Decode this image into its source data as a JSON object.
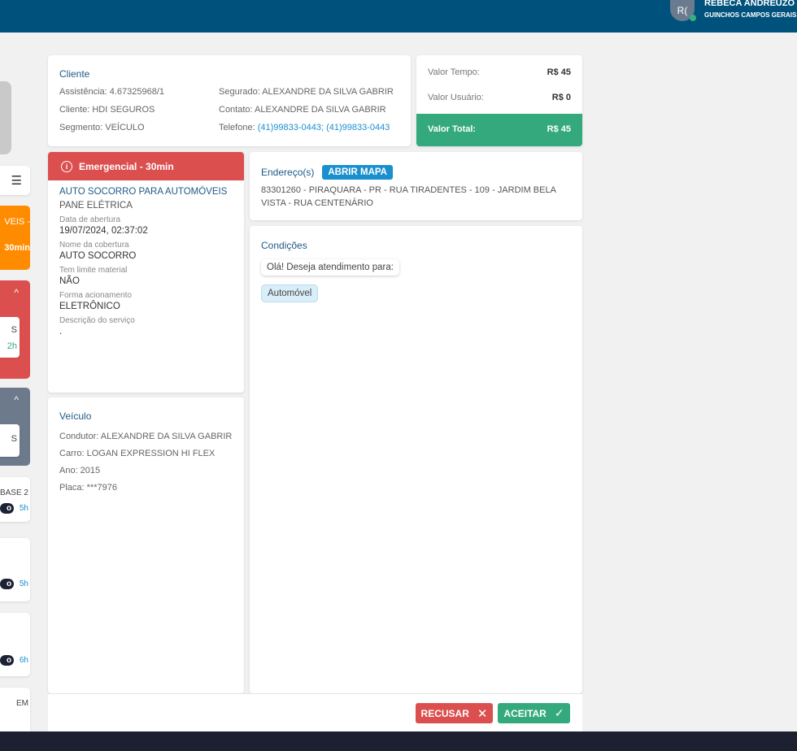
{
  "header": {
    "avatar_initials": "R(",
    "user_name": "REBECA ANDREUZO C",
    "company": "GUINCHOS CAMPOS GERAIS"
  },
  "sidebar": {
    "card1_text": "VEIS -",
    "card1_time": "30min",
    "card2_time": "2h",
    "card2_text": "S",
    "card3_text": "S",
    "card4_text": "BASE 2",
    "card4_badge": "o",
    "card4_time": "5h",
    "card5_badge": "o",
    "card5_time": "5h",
    "card6_badge": "o",
    "card6_time": "6h",
    "card7_text": "EM"
  },
  "cliente": {
    "title": "Cliente",
    "assistencia": "Assistência: 4.67325968/1",
    "cliente": "Cliente: HDI SEGUROS",
    "segmento": "Segmento: VEÍCULO",
    "segurado": "Segurado: ALEXANDRE DA SILVA GABRIR",
    "contato": "Contato: ALEXANDRE DA SILVA GABRIR",
    "telefone_label": "Telefone: ",
    "telefone": "(41)99833-0443; (41)99833-0443"
  },
  "valores": {
    "tempo_label": "Valor Tempo:",
    "tempo": "R$ 45",
    "usuario_label": "Valor Usuário:",
    "usuario": "R$ 0",
    "total_label": "Valor Total:",
    "total": "R$ 45"
  },
  "servico": {
    "priority": "Emergencial - 30min",
    "name": "AUTO SOCORRO PARA AUTOMÓVEIS",
    "problem": "PANE ELÉTRICA",
    "fields": [
      {
        "label": "Data de abertura",
        "value": "19/07/2024, 02:37:02"
      },
      {
        "label": "Nome da cobertura",
        "value": "AUTO SOCORRO"
      },
      {
        "label": "Tem limite material",
        "value": "NÃO"
      },
      {
        "label": "Forma acionamento",
        "value": "ELETRÔNICO"
      },
      {
        "label": "Descrição do serviço",
        "value": "."
      }
    ]
  },
  "veiculo": {
    "title": "Veículo",
    "condutor": "Condutor: ALEXANDRE DA SILVA GABRIR",
    "carro": "Carro: LOGAN EXPRESSION HI FLEX",
    "ano": "Ano: 2015",
    "placa": "Placa: ***7976"
  },
  "endereco": {
    "title": "Endereço(s)",
    "map_button": "ABRIR MAPA",
    "address": "83301260 - PIRAQUARA - PR - RUA TIRADENTES - 109 - JARDIM BELA VISTA - RUA CENTENÁRIO"
  },
  "condicoes": {
    "title": "Condições",
    "question": "Olá! Deseja atendimento para:",
    "answer": "Automóvel"
  },
  "actions": {
    "refuse": "RECUSAR",
    "accept": "ACEITAR"
  },
  "colors": {
    "header": "#00527c",
    "danger": "#dc4f4f",
    "success": "#35a97e",
    "warning": "#ff8c00",
    "link": "#1a8fd0"
  }
}
